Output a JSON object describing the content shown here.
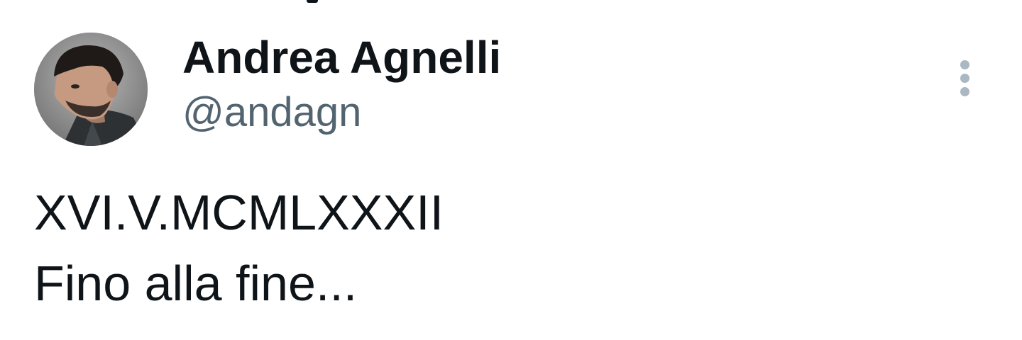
{
  "tweet": {
    "author": {
      "display_name": "Andrea Agnelli",
      "handle": "@andagn",
      "avatar_icon": "profile-photo"
    },
    "more_icon": "more-vertical-icon",
    "text_lines": [
      "XVI.V.MCMLXXXII",
      "Fino alla fine..."
    ]
  },
  "colors": {
    "name": "#0f1419",
    "handle": "#536471",
    "more_icon": "#aab8c2",
    "background": "#ffffff"
  }
}
